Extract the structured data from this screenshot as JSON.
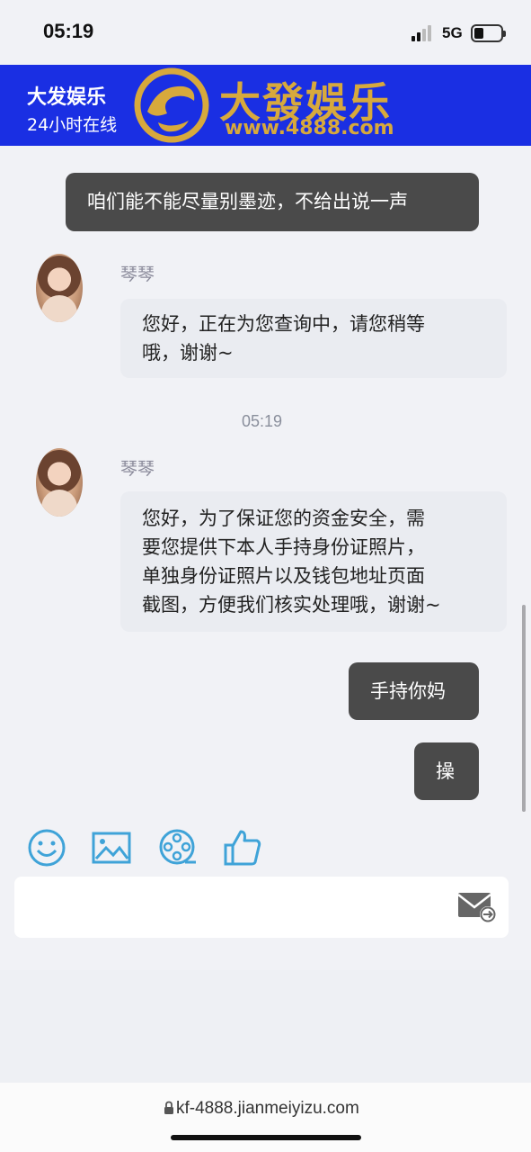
{
  "status_bar": {
    "time": "05:19",
    "network": "5G"
  },
  "header": {
    "title": "大发娱乐",
    "subtitle": "24小时在线",
    "brand_name": "大發娛乐",
    "brand_url": "www.4888.com"
  },
  "messages": [
    {
      "side": "right",
      "text": "咱们能不能尽量别墨迹，不给出说一声"
    },
    {
      "side": "left",
      "agent": "琴琴",
      "lines": [
        "您好，正在为您查询中，请您稍等",
        "哦，谢谢~"
      ]
    },
    {
      "side": "time",
      "text": "05:19"
    },
    {
      "side": "left",
      "agent": "琴琴",
      "lines": [
        "您好，为了保证您的资金安全，需",
        "要您提供下本人手持身份证照片，",
        "单独身份证照片以及钱包地址页面",
        "截图，方便我们核实处理哦，谢谢~"
      ]
    },
    {
      "side": "right",
      "text": "手持你妈"
    },
    {
      "side": "right",
      "text": "操"
    }
  ],
  "toolbar": {
    "icons": [
      "emoji-icon",
      "image-icon",
      "video-icon",
      "thumbs-up-icon"
    ]
  },
  "input": {
    "value": "",
    "send_icon": "send-mail-icon"
  },
  "url_bar": {
    "url": "kf-4888.jianmeiyizu.com"
  },
  "colors": {
    "header_bg": "#1a2fe3",
    "brand_gold": "#d7a93c",
    "bubble_self": "#4a4a4a",
    "bubble_agent": "#eaecf1",
    "icon_blue": "#3fa3d8"
  }
}
